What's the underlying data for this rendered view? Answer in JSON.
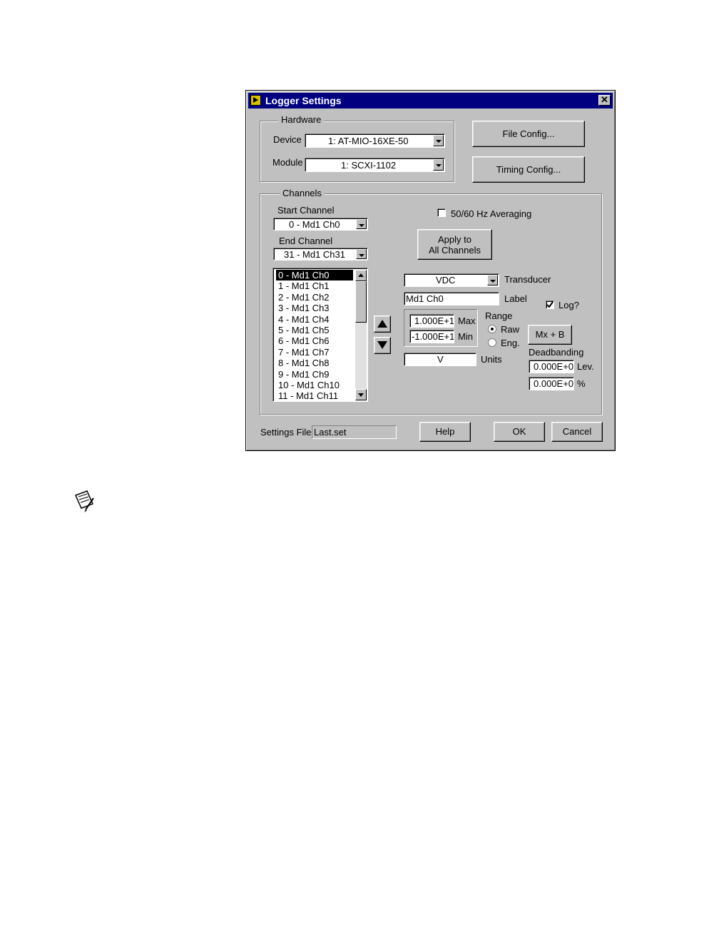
{
  "window": {
    "title": "Logger Settings",
    "close_symbol": "✕"
  },
  "hardware": {
    "legend": "Hardware",
    "device_label": "Device",
    "device_value": "1: AT-MIO-16XE-50",
    "module_label": "Module",
    "module_value": "1: SCXI-1102"
  },
  "buttons": {
    "file_config": "File Config...",
    "timing_config": "Timing Config...",
    "apply_line1": "Apply to",
    "apply_line2": "All Channels",
    "mxb": "Mx + B",
    "help": "Help",
    "ok": "OK",
    "cancel": "Cancel"
  },
  "channels": {
    "legend": "Channels",
    "start_label": "Start Channel",
    "start_value": "0 - Md1 Ch0",
    "end_label": "End Channel",
    "end_value": "31 - Md1 Ch31",
    "averaging_label": "50/60 Hz Averaging",
    "list": [
      "0 - Md1 Ch0",
      "1 - Md1 Ch1",
      "2 - Md1 Ch2",
      "3 - Md1 Ch3",
      "4 - Md1 Ch4",
      "5 - Md1 Ch5",
      "6 - Md1 Ch6",
      "7 - Md1 Ch7",
      "8 - Md1 Ch8",
      "9 - Md1 Ch9",
      "10 - Md1 Ch10",
      "11 - Md1 Ch11"
    ],
    "selected_index": 0
  },
  "channel_config": {
    "transducer_value": "VDC",
    "transducer_label": "Transducer",
    "label_value": "Md1 Ch0",
    "label_label": "Label",
    "log_label": "Log?",
    "log_checked": true,
    "max_value": "1.000E+1",
    "max_label": "Max",
    "min_value": "-1.000E+1",
    "min_label": "Min",
    "range_label": "Range",
    "raw_label": "Raw",
    "eng_label": "Eng.",
    "range_selected": "Raw",
    "units_value": "V",
    "units_label": "Units",
    "deadbanding_label": "Deadbanding",
    "lev_value": "0.000E+0",
    "lev_label": "Lev.",
    "pct_value": "0.000E+0",
    "pct_label": "%"
  },
  "footer": {
    "settings_file_label": "Settings File",
    "settings_file_value": "Last.set"
  }
}
